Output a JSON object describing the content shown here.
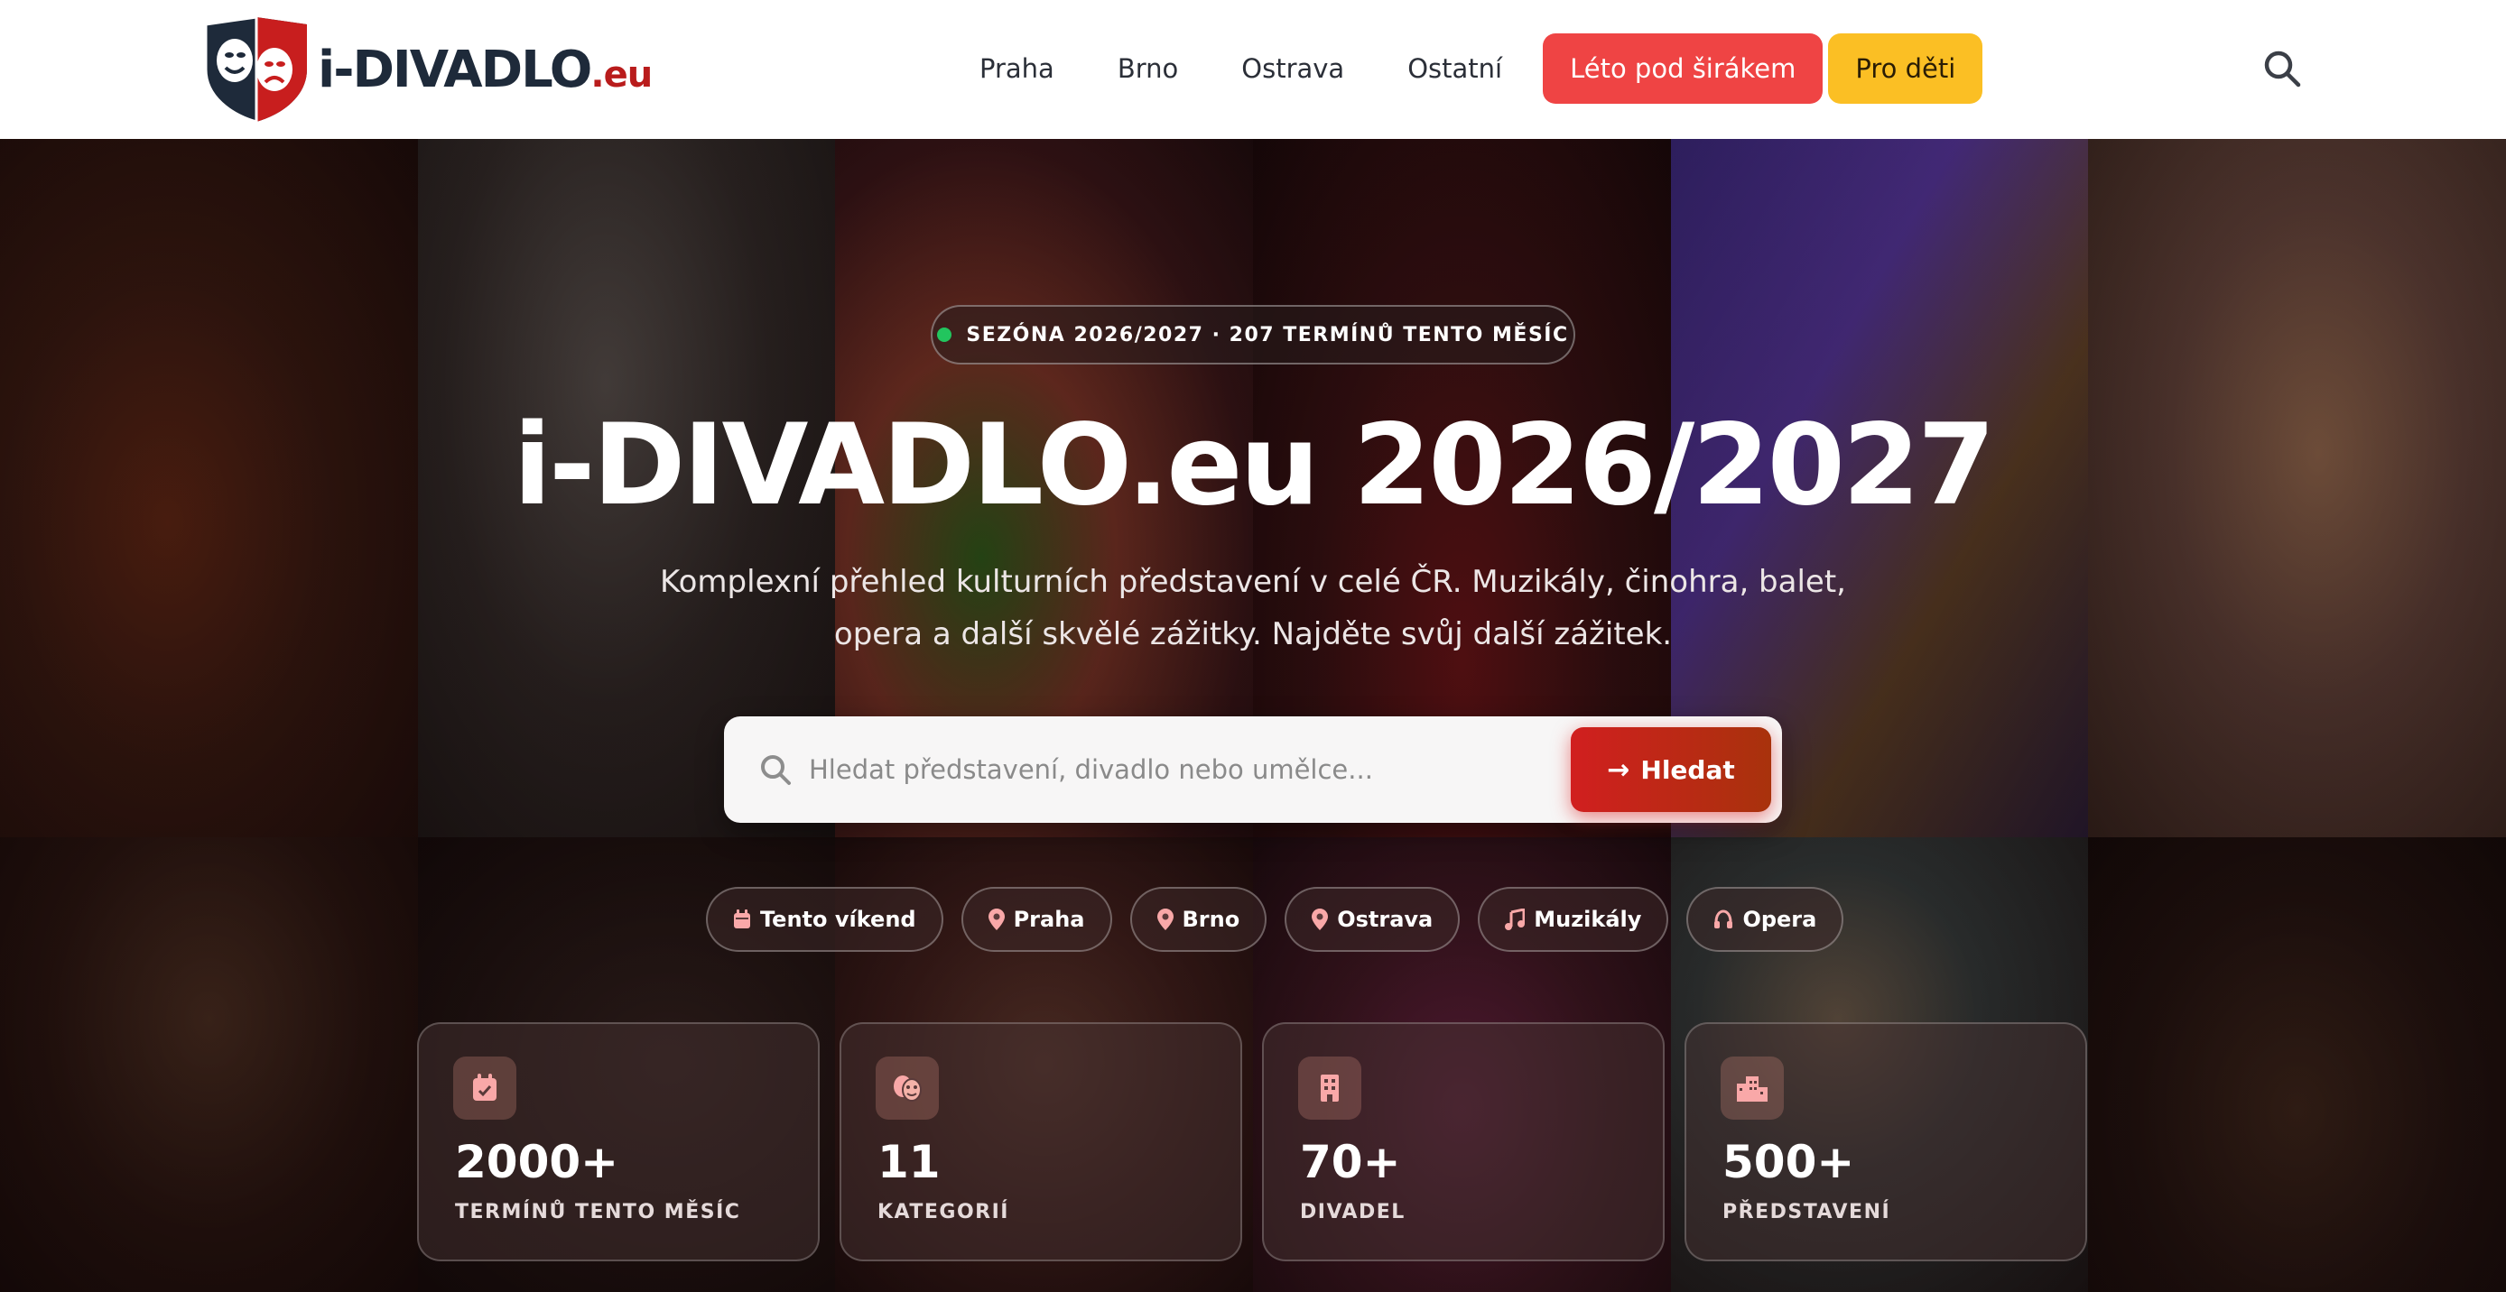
{
  "brand": {
    "name": "i-DIVADLO",
    "tld": ".eu"
  },
  "nav": {
    "links": [
      "Praha",
      "Brno",
      "Ostrava",
      "Ostatní"
    ],
    "summer_button": "Léto pod širákem",
    "kids_button": "Pro děti"
  },
  "hero": {
    "badge": "SEZÓNA 2026/2027 · 207 TERMÍNŮ TENTO MĚSÍC",
    "title": "i-DIVADLO.eu 2026/2027",
    "subtitle_line1": "Komplexní přehled kulturních představení v celé ČR. Muzikály, činohra, balet,",
    "subtitle_line2": "opera a další skvělé zážitky. Najděte svůj další zážitek."
  },
  "search": {
    "placeholder": "Hledat představení, divadlo nebo umělce...",
    "button": "Hledat"
  },
  "chips": [
    {
      "label": "Tento víkend",
      "icon": "calendar-icon"
    },
    {
      "label": "Praha",
      "icon": "map-pin-icon"
    },
    {
      "label": "Brno",
      "icon": "map-pin-icon"
    },
    {
      "label": "Ostrava",
      "icon": "map-pin-icon"
    },
    {
      "label": "Muzikály",
      "icon": "music-note-icon"
    },
    {
      "label": "Opera",
      "icon": "headphones-icon"
    }
  ],
  "stats": [
    {
      "value": "2000+",
      "label": "TERMÍNŮ TENTO MĚSÍC",
      "icon": "calendar-check-icon"
    },
    {
      "value": "11",
      "label": "KATEGORIÍ",
      "icon": "theater-masks-icon"
    },
    {
      "value": "70+",
      "label": "DIVADEL",
      "icon": "building-icon"
    },
    {
      "value": "500+",
      "label": "PŘEDSTAVENÍ",
      "icon": "city-icon"
    }
  ],
  "colors": {
    "accent_red": "#ef4444",
    "accent_yellow": "#fbbf24",
    "search_button": "#d11f1f",
    "badge_dot": "#22c55e",
    "brand_navy": "#1e2a3a",
    "brand_red": "#b91c1c"
  }
}
